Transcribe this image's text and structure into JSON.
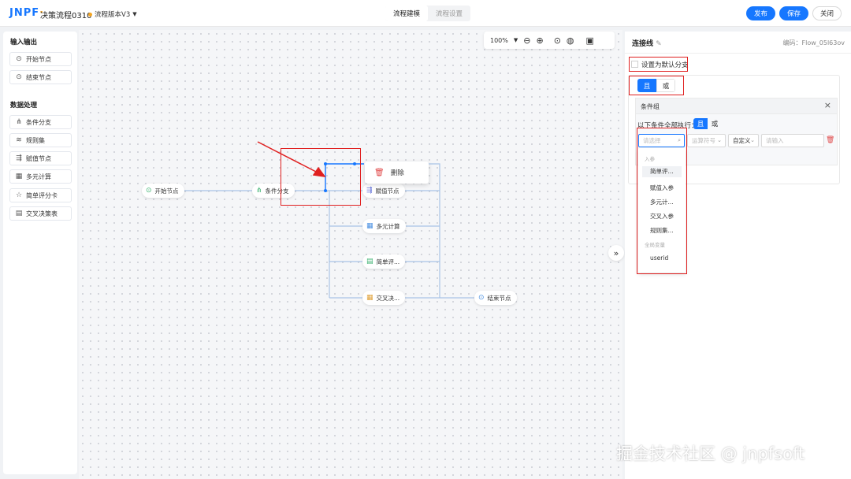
{
  "header": {
    "logo": {
      "part1": "JNPF",
      "part2": "·"
    },
    "flow_name": "决策流程0310",
    "version": "流程版本V3",
    "tabs": [
      "流程建模",
      "流程设置"
    ],
    "publish_label": "发布",
    "save_label": "保存",
    "close_label": "关闭",
    "accent": "#1677ff"
  },
  "sidebar": {
    "sections": [
      {
        "title": "输入输出",
        "items": [
          {
            "label": "开始节点",
            "icon": "play-circle-icon"
          },
          {
            "label": "结束节点",
            "icon": "stop-circle-icon"
          }
        ]
      },
      {
        "title": "数据处理",
        "items": [
          {
            "label": "条件分支",
            "icon": "branch-icon"
          },
          {
            "label": "规则集",
            "icon": "layers-icon"
          },
          {
            "label": "赋值节点",
            "icon": "assign-icon"
          },
          {
            "label": "多元计算",
            "icon": "calculator-icon"
          },
          {
            "label": "简单评分卡",
            "icon": "star-icon"
          },
          {
            "label": "交叉决策表",
            "icon": "table-icon"
          }
        ]
      }
    ]
  },
  "canvas": {
    "zoom": "100%",
    "nodes": {
      "start": "开始节点",
      "branch": "条件分支",
      "assign": "赋值节点",
      "multi": "多元计算",
      "score": "简单评...",
      "cross": "交叉决...",
      "end": "结束节点"
    },
    "context_menu": {
      "delete_label": "删除"
    }
  },
  "right_panel": {
    "title": "连接线",
    "code": "编码：Flow_05l63ov",
    "default_branch_label": "设置为默认分支",
    "logic": {
      "and": "且",
      "or": "或"
    },
    "condition_group": {
      "title": "条件组",
      "all_label": "以下条件全部执行：",
      "field_placeholder": "请选择",
      "operator_placeholder": "运算符号",
      "value_type": "自定义",
      "value_placeholder": "请输入"
    },
    "dropdown": {
      "group_params": "入参",
      "items": [
        "简单评...",
        "赋值入参",
        "多元计...",
        "交叉入参",
        "规则集..."
      ],
      "group_globals": "全局变量",
      "global_items": [
        "userid"
      ]
    }
  },
  "watermark": "掘金技术社区 @ jnpfsoft"
}
